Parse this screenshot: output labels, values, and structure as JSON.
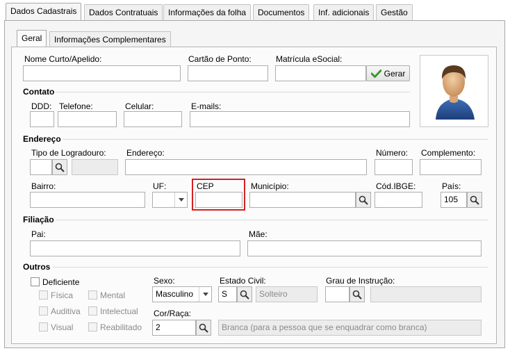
{
  "tabs": [
    {
      "label": "Dados Cadastrais",
      "active": true
    },
    {
      "label": "Dados Contratuais"
    },
    {
      "label": "Informações da folha"
    },
    {
      "label": "Documentos"
    },
    {
      "label": "Inf. adicionais"
    },
    {
      "label": "Gestão"
    }
  ],
  "subtabs": [
    {
      "label": "Geral",
      "active": true
    },
    {
      "label": "Informações Complementares"
    }
  ],
  "top": {
    "nome_curto_label": "Nome Curto/Apelido:",
    "cartao_label": "Cartão de Ponto:",
    "matricula_label": "Matrícula eSocial:",
    "gerar_label": "Gerar"
  },
  "contato": {
    "title": "Contato",
    "ddd_label": "DDD:",
    "telefone_label": "Telefone:",
    "celular_label": "Celular:",
    "emails_label": "E-mails:"
  },
  "endereco": {
    "title": "Endereço",
    "tipo_logradouro_label": "Tipo de Logradouro:",
    "endereco_label": "Endereço:",
    "numero_label": "Número:",
    "complemento_label": "Complemento:",
    "bairro_label": "Bairro:",
    "uf_label": "UF:",
    "cep_label": "CEP",
    "municipio_label": "Município:",
    "cod_ibge_label": "Cód.IBGE:",
    "pais_label": "País:",
    "pais_value": "105"
  },
  "filiacao": {
    "title": "Filiação",
    "pai_label": "Pai:",
    "mae_label": "Mãe:"
  },
  "outros": {
    "title": "Outros",
    "deficiente_label": "Deficiente",
    "fisica_label": "Física",
    "mental_label": "Mental",
    "auditiva_label": "Auditiva",
    "intelectual_label": "Intelectual",
    "visual_label": "Visual",
    "reabilitado_label": "Reabilitado",
    "sexo_label": "Sexo:",
    "sexo_value": "Masculino",
    "estado_civil_label": "Estado Civil:",
    "estado_civil_code": "S",
    "estado_civil_desc": "Solteiro",
    "grau_instrucao_label": "Grau de Instrução:",
    "cor_raca_label": "Cor/Raça:",
    "cor_raca_code": "2",
    "cor_raca_desc": "Branca (para a pessoa que se enquadrar como branca)"
  },
  "colors": {
    "highlight": "#d42121",
    "gerar_check": "#3a9a2a"
  }
}
